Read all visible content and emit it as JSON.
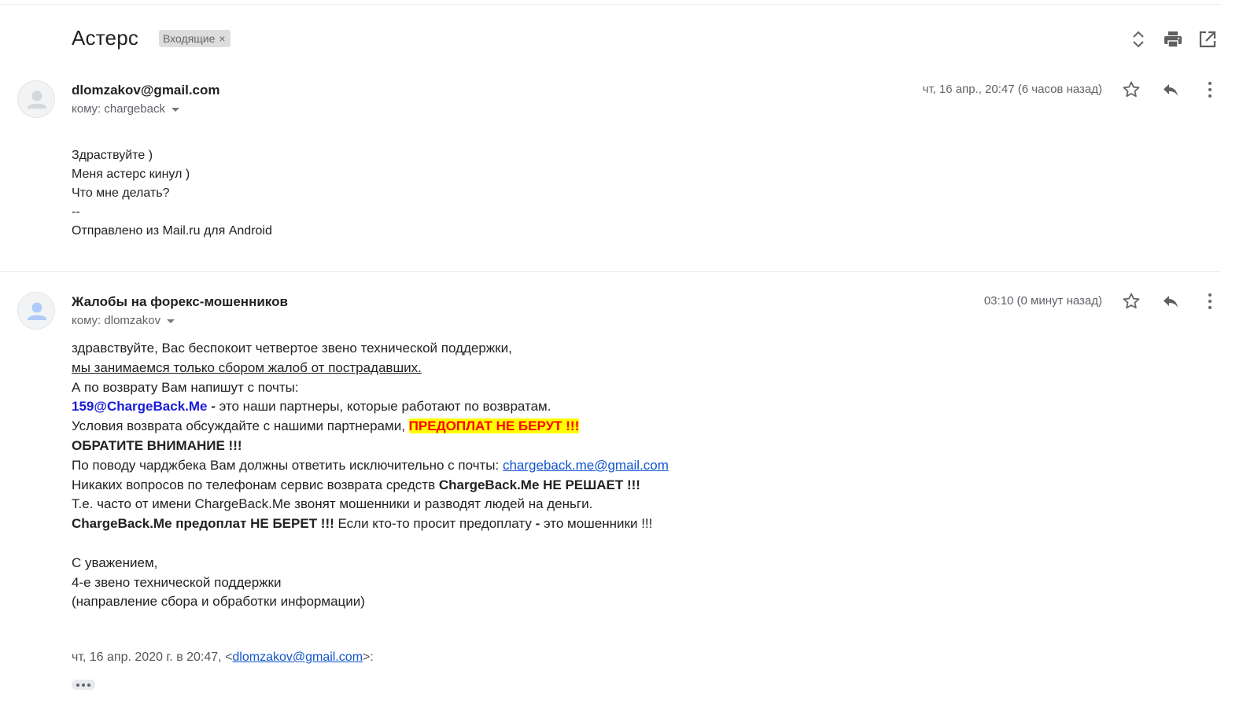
{
  "thread": {
    "subject": "Астерс",
    "label": "Входящие",
    "label_remove": "×"
  },
  "icons": {
    "expand": "unfold-icon",
    "print": "print-icon",
    "open_new": "open-in-new-icon",
    "star": "star-icon",
    "reply": "reply-icon",
    "more": "more-vert-icon",
    "avatar": "person-icon"
  },
  "messages": [
    {
      "sender": "dlomzakov@gmail.com",
      "to": "кому: chargeback",
      "date": "чт, 16 апр., 20:47 (6 часов назад)",
      "body": [
        "Здраствуйте )",
        "Меня астерс кинул )",
        "Что мне делать?",
        "--",
        "Отправлено из Mail.ru для Android"
      ]
    },
    {
      "sender": "Жалобы на форекс-мошенников",
      "to": "кому: dlomzakov",
      "date": "03:10 (0 минут назад)",
      "body": {
        "l1": "здравствуйте, Вас беспокоит четвертое звено технической поддержки,",
        "l2": "мы занимаемся только сбором жалоб от пострадавших.",
        "l3": "А по возврату Вам напишут с почты:",
        "l4_email": "159@ChargeBack.Me",
        "l4_dash": " - ",
        "l4_rest": "это наши партнеры, которые работают по возвратам.",
        "l5_text": "Условия возврата обсуждайте с нашими партнерами, ",
        "l5_hl": "ПРЕДОПЛАТ НЕ БЕРУТ !!!",
        "l6": "ОБРАТИТЕ ВНИМАНИЕ !!!",
        "l7_text": "По поводу чарджбека Вам должны ответить исключительно с почты: ",
        "l7_link": "chargeback.me@gmail.com",
        "l8_text": "Никаких вопросов по телефонам сервис возврата средств ",
        "l8_bold": "ChargeBack.Me НЕ РЕШАЕТ !!!",
        "l9": "Т.е. часто от имени ChargeBack.Me звонят мошенники и разводят людей на деньги.",
        "l10_bold": "ChargeBack.Me предоплат НЕ БЕРЕТ !!!",
        "l10_text1": " Если кто-то просит предоплату ",
        "l10_dash": "-",
        "l10_text2": " это мошенники !!!",
        "sig1": "С уважением,",
        "sig2": "4-е звено технической поддержки",
        "sig3": "(направление сбора и обработки информации)"
      },
      "quote_prefix": "чт, 16 апр. 2020 г. в 20:47, <",
      "quote_email": "dlomzakov@gmail.com",
      "quote_suffix": ">:"
    }
  ],
  "colors": {
    "highlight_bg": "#ffff00",
    "highlight_text": "#ff0000",
    "email_blue": "#1a1adb",
    "link": "#1155cc"
  }
}
